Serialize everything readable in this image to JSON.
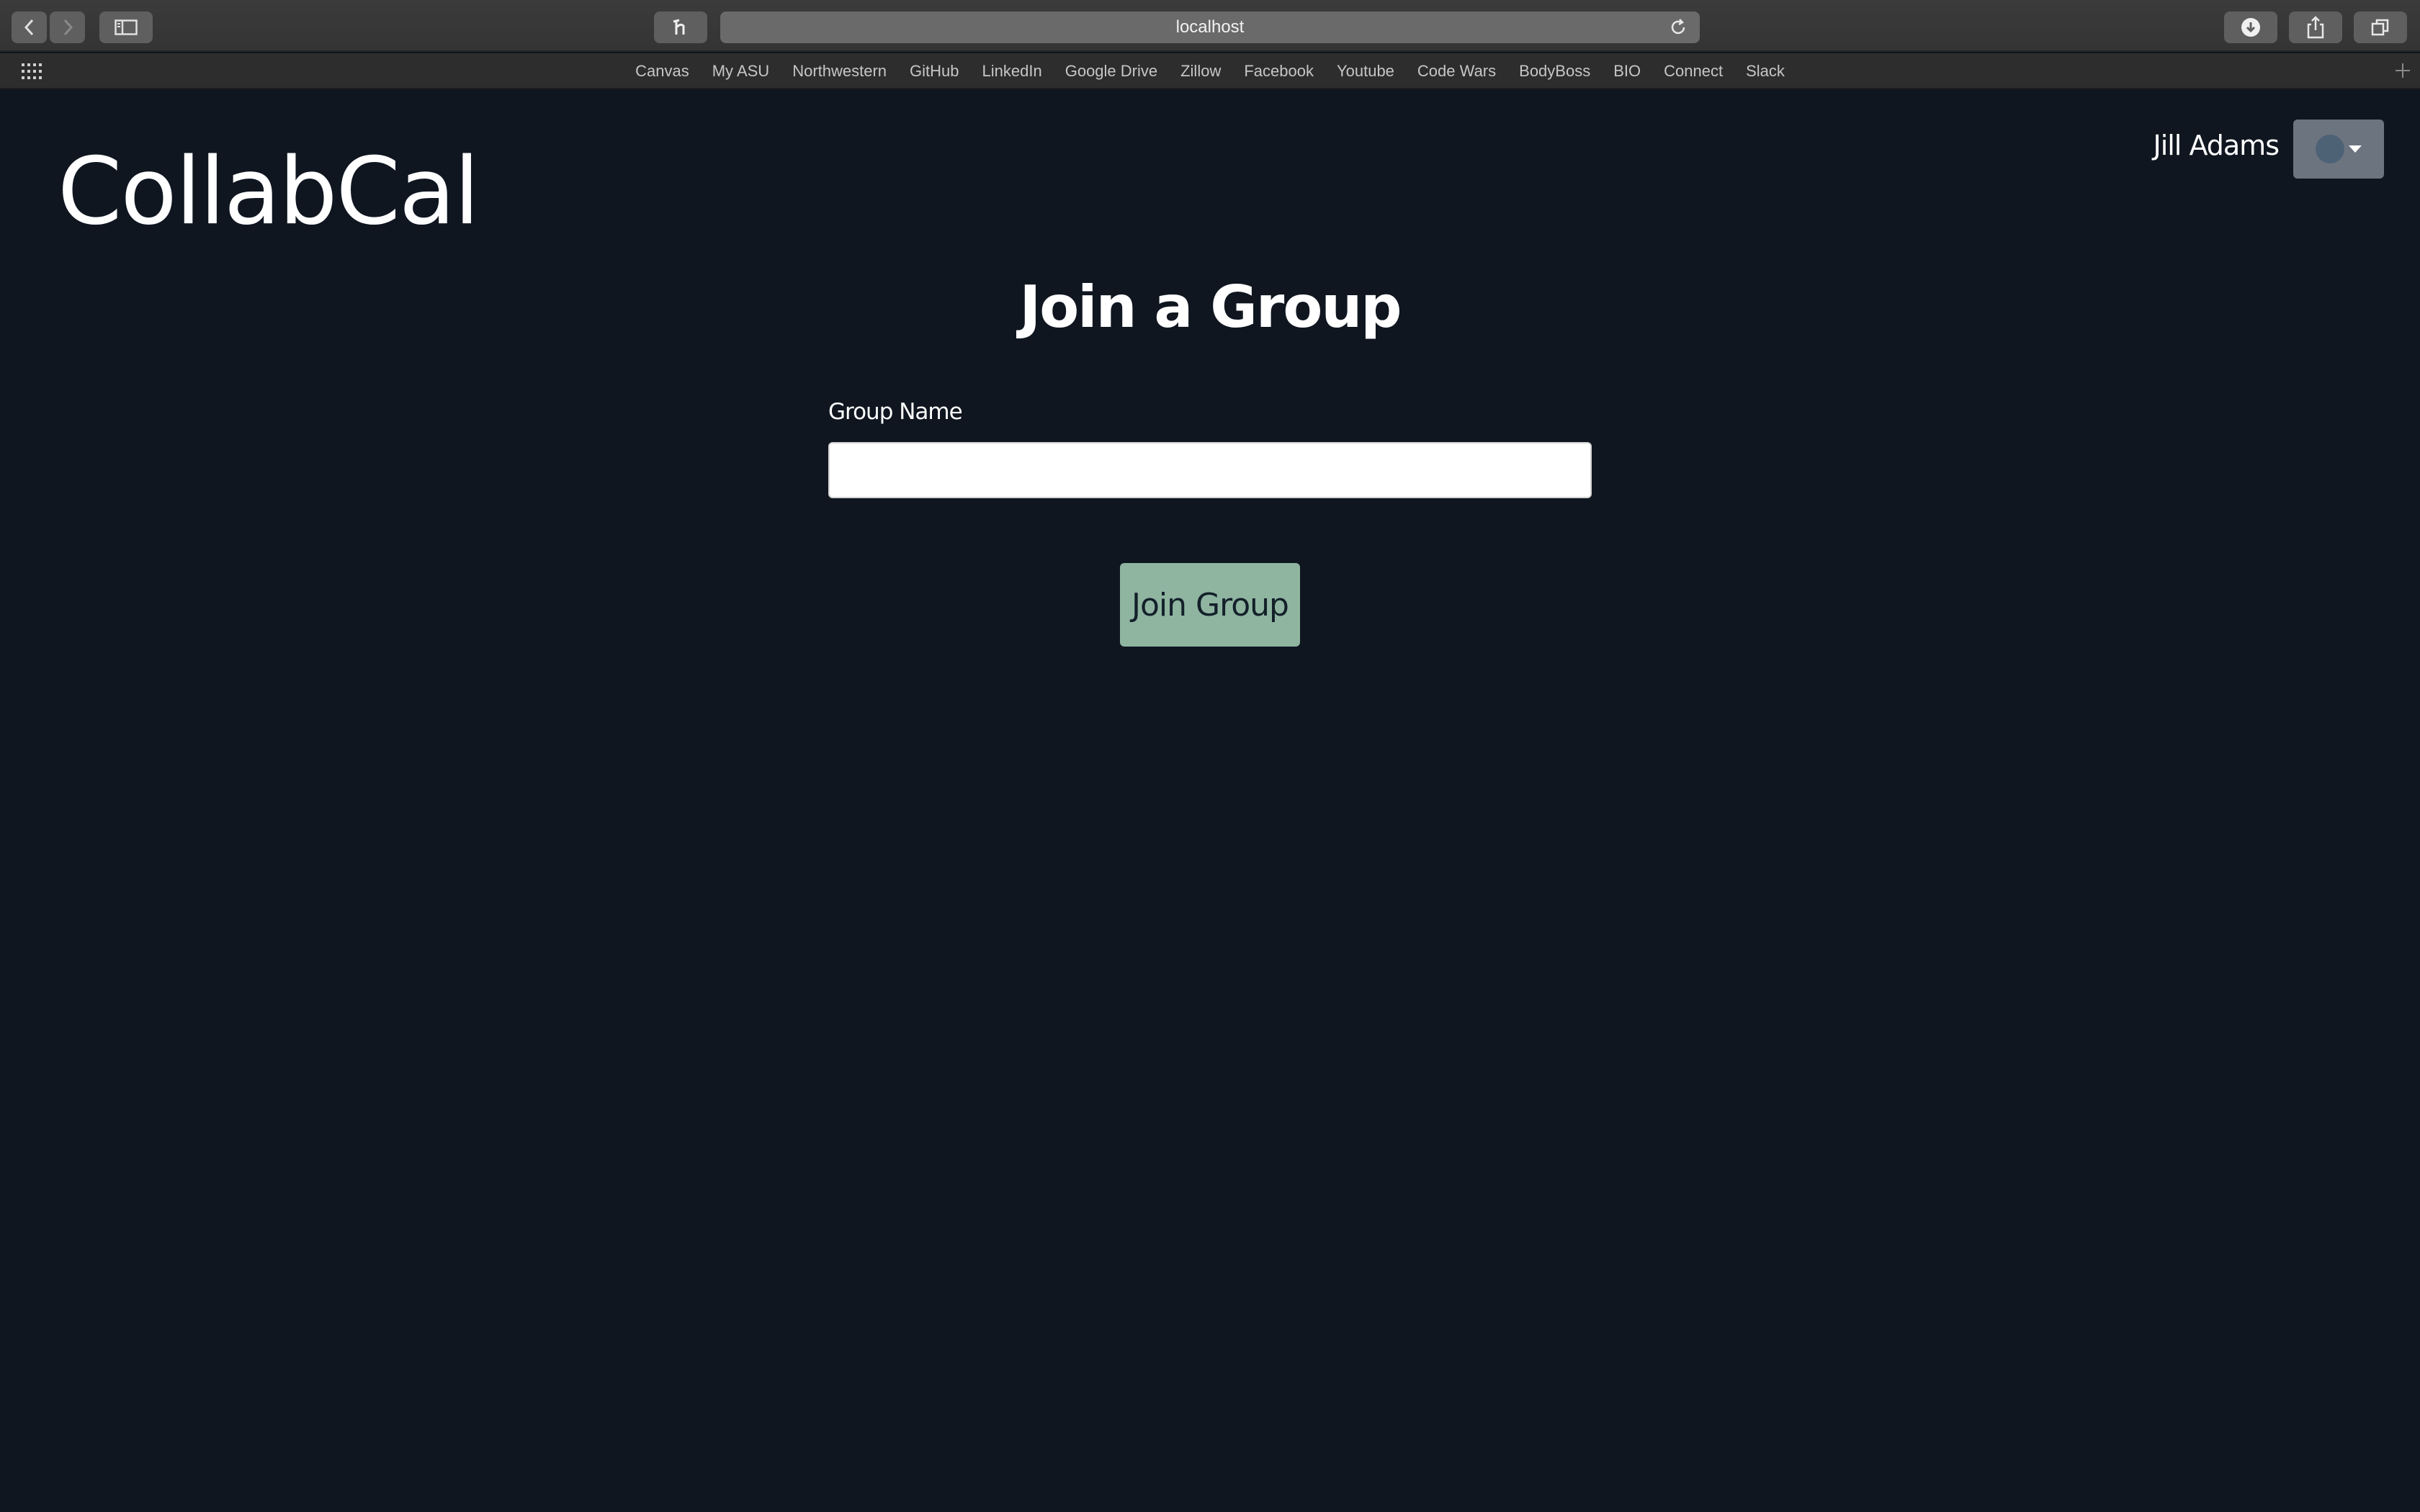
{
  "browser": {
    "url": "localhost",
    "bookmarks": [
      "Canvas",
      "My ASU",
      "Northwestern",
      "GitHub",
      "LinkedIn",
      "Google Drive",
      "Zillow",
      "Facebook",
      "Youtube",
      "Code Wars",
      "BodyBoss",
      "BIO",
      "Connect",
      "Slack"
    ]
  },
  "header": {
    "brand": "CollabCal",
    "user_name": "Jill Adams"
  },
  "main": {
    "title": "Join a Group",
    "group_name_label": "Group Name",
    "group_name_value": "",
    "group_name_placeholder": "",
    "submit_label": "Join Group"
  },
  "colors": {
    "background": "#0f1620",
    "button": "#8fb5a0",
    "avatar_button": "#6c7480"
  }
}
